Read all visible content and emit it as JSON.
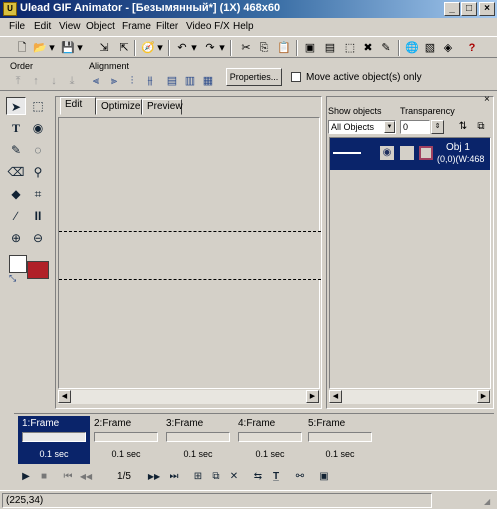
{
  "window": {
    "title": "Ulead GIF Animator - [Безымянный*] (1X) 468x60",
    "icon_label": "U",
    "minimize": "_",
    "maximize": "□",
    "close": "×"
  },
  "menu": [
    "File",
    "Edit",
    "View",
    "Object",
    "Frame",
    "Filter",
    "Video F/X",
    "Help"
  ],
  "toolbar": {
    "icons": [
      "new-icon",
      "open-icon",
      "open-dropdown-icon",
      "save-icon",
      "save-dropdown-icon",
      "import-icon",
      "export-icon",
      "optimize-icon",
      "optimize-dropdown-icon",
      "undo-icon",
      "undo-dropdown-icon",
      "redo-icon",
      "redo-dropdown-icon",
      "cut-icon",
      "copy-icon",
      "paste-icon",
      "add-frame-icon",
      "duplicate-frame-icon",
      "add-text-icon",
      "delete-icon",
      "edit-icon",
      "browser-preview-icon",
      "animation-wizard-icon",
      "view-icon",
      "help-icon"
    ],
    "glyphs": [
      "🗋",
      "📂",
      "▾",
      "💾",
      "▾",
      "⇲",
      "⇱",
      "🧭",
      "▾",
      "↶",
      "▾",
      "↷",
      "▾",
      "✂",
      "⎘",
      "📋",
      "▣",
      "▤",
      "⬚",
      "✖",
      "✎",
      "🌐",
      "▧",
      "◈",
      "?"
    ]
  },
  "object_toolbar": {
    "order_label": "Order",
    "alignment_label": "Alignment",
    "properties_label": "Properties...",
    "move_active_label": "Move active object(s) only",
    "order_glyphs": [
      "⤒",
      "↑",
      "↓",
      "⤓"
    ],
    "align_glyphs": [
      "⫷",
      "⫸",
      "⫶",
      "⫵",
      "▤",
      "▥",
      "▦"
    ]
  },
  "tools": [
    {
      "name": "pick-tool-icon",
      "glyph": "➤"
    },
    {
      "name": "marquee-tool-icon",
      "glyph": "⬚"
    },
    {
      "name": "text-tool-icon",
      "glyph": "T"
    },
    {
      "name": "eye-dropper-icon",
      "glyph": "◉"
    },
    {
      "name": "paintbrush-icon",
      "glyph": "✎"
    },
    {
      "name": "lasso-icon",
      "glyph": "◌"
    },
    {
      "name": "eraser-icon",
      "glyph": "⌫"
    },
    {
      "name": "magic-wand-icon",
      "glyph": "⚲"
    },
    {
      "name": "paint-bucket-icon",
      "glyph": "◆"
    },
    {
      "name": "crop-icon",
      "glyph": "⌗"
    },
    {
      "name": "pen-icon",
      "glyph": "∕"
    },
    {
      "name": "transform-icon",
      "glyph": "II"
    },
    {
      "name": "zoom-in-icon",
      "glyph": "⊕"
    },
    {
      "name": "zoom-out-icon",
      "glyph": "⊖"
    }
  ],
  "colors": {
    "background": "#ffffff",
    "foreground": "#b02028",
    "swap_glyph": "⤡"
  },
  "editor": {
    "tabs": [
      "Edit",
      "Optimize",
      "Preview"
    ],
    "scroll_left": "◀",
    "scroll_right": "▶"
  },
  "objects_panel": {
    "show_objects_label": "Show objects",
    "show_objects_value": "All Objects",
    "transparency_label": "Transparency",
    "transparency_value": "0",
    "close_glyph": "×",
    "object_name": "Obj 1",
    "object_info": "(0,0)(W:468",
    "visible_glyph": "◉",
    "scroll_left": "◀",
    "scroll_right": "▶"
  },
  "frames": [
    {
      "name": "1:Frame",
      "delay": "0.1 sec"
    },
    {
      "name": "2:Frame",
      "delay": "0.1 sec"
    },
    {
      "name": "3:Frame",
      "delay": "0.1 sec"
    },
    {
      "name": "4:Frame",
      "delay": "0.1 sec"
    },
    {
      "name": "5:Frame",
      "delay": "0.1 sec"
    }
  ],
  "playback": {
    "counter": "1/5",
    "glyphs": {
      "play": "▶",
      "stop": "■",
      "first": "⏮",
      "prev": "◀◀",
      "next": "▶▶",
      "last": "⏭",
      "add": "⊞",
      "dup": "⧉",
      "del": "✕",
      "tween": "⇆",
      "text": "T̲",
      "wiz": "⚯",
      "prop": "▣"
    }
  },
  "status": {
    "coords": "(225,34)"
  }
}
